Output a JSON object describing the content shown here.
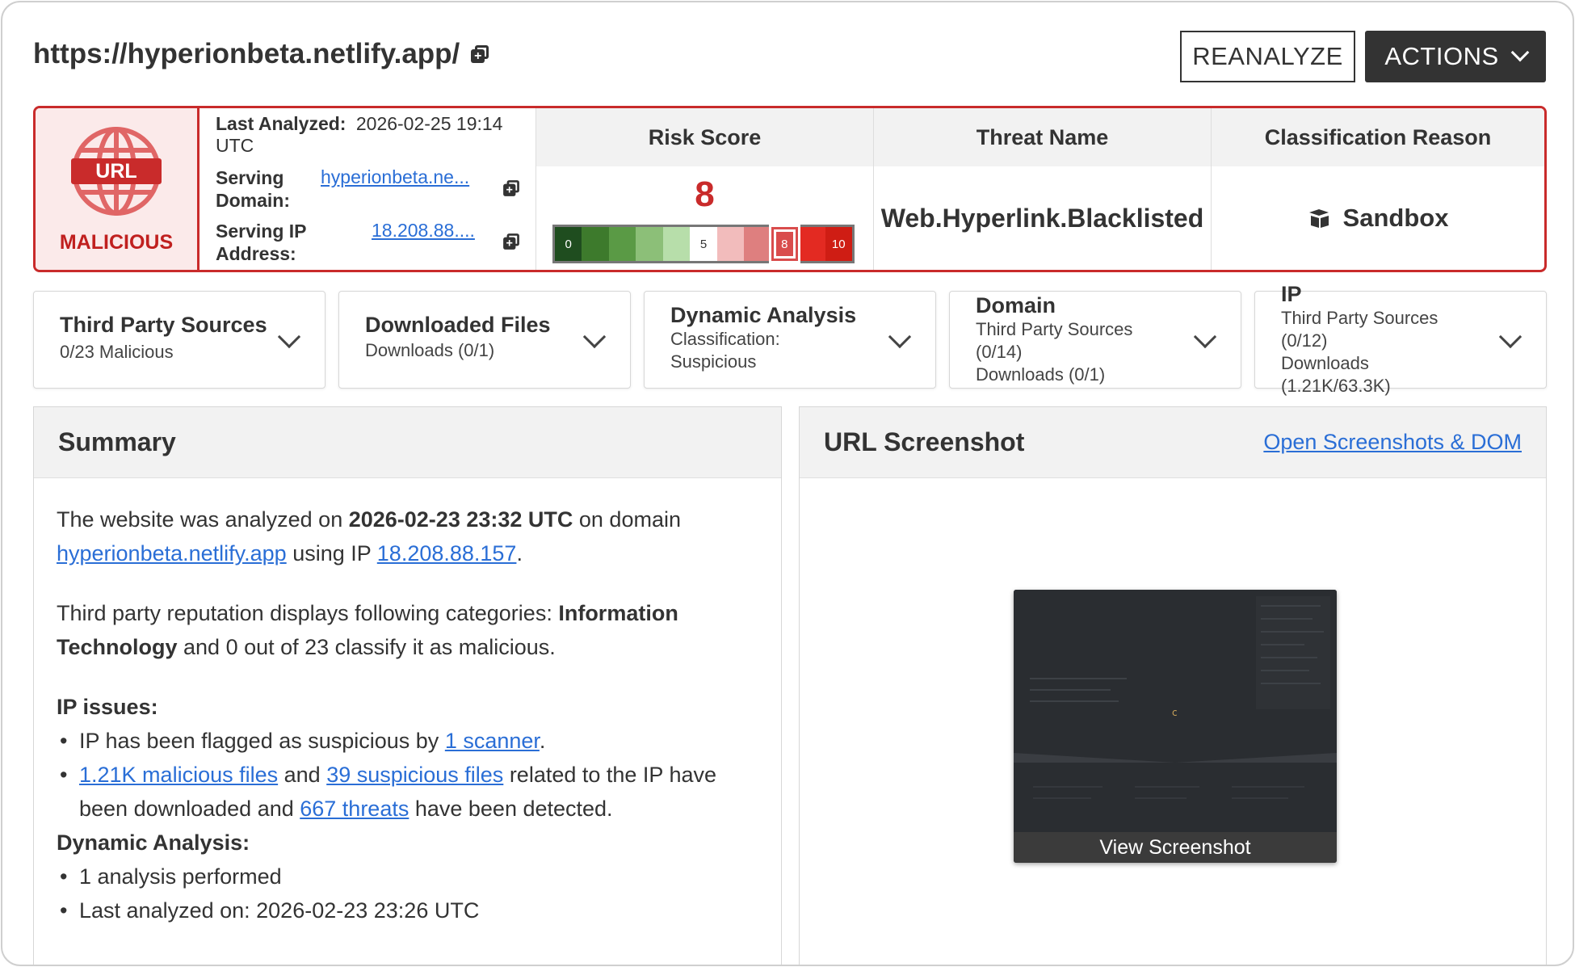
{
  "header": {
    "url": "https://hyperionbeta.netlify.app/",
    "reanalyze_label": "REANALYZE",
    "actions_label": "ACTIONS"
  },
  "verdict": {
    "badge_icon_text": "URL",
    "classification": "MALICIOUS",
    "last_analyzed_key": "Last Analyzed:",
    "last_analyzed_value": "2026-02-25 19:14",
    "last_analyzed_tz": "UTC",
    "serving_domain_key_1": "Serving",
    "serving_domain_key_2": "Domain:",
    "serving_domain_value": "hyperionbeta.ne...",
    "serving_ip_key_1": "Serving IP",
    "serving_ip_key_2": "Address:",
    "serving_ip_value": "18.208.88....",
    "risk_score_label": "Risk Score",
    "risk_score": "8",
    "risk_scale": [
      {
        "label": "0",
        "color": "#1f4d1f"
      },
      {
        "label": "",
        "color": "#3d7a2c"
      },
      {
        "label": "",
        "color": "#5a9a45"
      },
      {
        "label": "",
        "color": "#8cbf78"
      },
      {
        "label": "",
        "color": "#b7deaa"
      },
      {
        "label": "5",
        "color": "#ffffff"
      },
      {
        "label": "",
        "color": "#f2bcbc"
      },
      {
        "label": "",
        "color": "#de7f7f"
      },
      {
        "label": "8",
        "color": "#d94c4c"
      },
      {
        "label": "",
        "color": "#e32a22"
      },
      {
        "label": "10",
        "color": "#cf1d14"
      }
    ],
    "threat_name_label": "Threat Name",
    "threat_name": "Web.Hyperlink.Blacklisted",
    "classification_reason_label": "Classification Reason",
    "classification_reason": "Sandbox"
  },
  "cards": {
    "third_party": {
      "title": "Third Party Sources",
      "line1": "0/23 Malicious"
    },
    "downloaded": {
      "title": "Downloaded Files",
      "line1": "Downloads (0/1)"
    },
    "dynamic": {
      "title": "Dynamic Analysis",
      "line1": "Classification:",
      "line2": "Suspicious"
    },
    "domain": {
      "title": "Domain",
      "line1": "Third Party Sources",
      "line2": "(0/14)",
      "line3": "Downloads (0/1)"
    },
    "ip": {
      "title": "IP",
      "line1": "Third Party Sources",
      "line2": "(0/12)",
      "line3": "Downloads",
      "line4": "(1.21K/63.3K)"
    }
  },
  "summary": {
    "title": "Summary",
    "p1_a": "The website was analyzed on ",
    "p1_date": "2026-02-23 23:32 UTC",
    "p1_b": " on domain ",
    "p1_domain": "hyperionbeta.netlify.app",
    "p1_c": " using IP ",
    "p1_ip": "18.208.88.157",
    "p1_d": ".",
    "p2_a": "Third party reputation displays following categories: ",
    "p2_cat": "Information Technology",
    "p2_b": " and 0 out of 23 classify it as malicious.",
    "ip_issues_title": "IP issues:",
    "ip_issue1_a": "IP has been flagged as suspicious by ",
    "ip_issue1_link": "1 scanner",
    "ip_issue1_b": ".",
    "ip_issue2_link1": "1.21K malicious files",
    "ip_issue2_a": " and ",
    "ip_issue2_link2": "39 suspicious files",
    "ip_issue2_b": " related to the IP have been downloaded and ",
    "ip_issue2_link3": "667 threats",
    "ip_issue2_c": " have been detected.",
    "dynamic_title": "Dynamic Analysis:",
    "dynamic_item1": "1 analysis performed",
    "dynamic_item2": "Last analyzed on: 2026-02-23 23:26 UTC"
  },
  "screenshot": {
    "title": "URL Screenshot",
    "open_link": "Open Screenshots & DOM",
    "caption": "View Screenshot"
  }
}
